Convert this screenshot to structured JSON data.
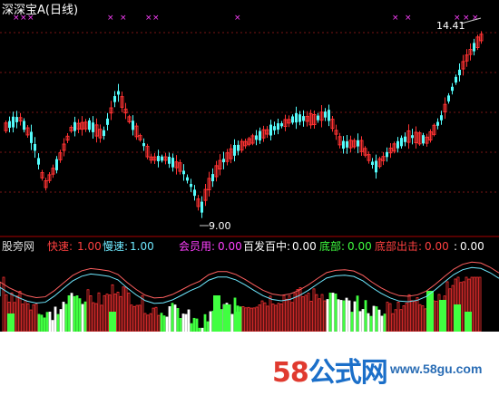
{
  "window": {
    "title": "深深宝A",
    "period": "(日线)"
  },
  "price_labels": {
    "high": "14.41",
    "low": "9.00"
  },
  "indicator": {
    "name": "股旁网",
    "params": [
      {
        "label": "快速:",
        "value": "1.00",
        "color": "#ff4040"
      },
      {
        "label": "慢速:",
        "value": "1.00",
        "color": "#6fe9ff"
      },
      {
        "label": "会员用:",
        "value": "0.00",
        "color": "#ff40ff"
      },
      {
        "label": "百发百中:",
        "value": "0.00",
        "color": "#ffffff"
      },
      {
        "label": "底部:",
        "value": "0.00",
        "color": "#40ff40"
      },
      {
        "label": "底部出击:",
        "value": "0.00",
        "color": "#ff4040"
      },
      {
        "label": ":",
        "value": "0.00",
        "color": "#ffffff"
      }
    ]
  },
  "watermark": {
    "logo_digits": "58",
    "logo_text": "公式网",
    "url": "www.58gu.com"
  },
  "colors": {
    "up": "#ff3232",
    "down": "#54fcfc",
    "grid": "#7a1414",
    "mark": "#ff40ff"
  }
}
